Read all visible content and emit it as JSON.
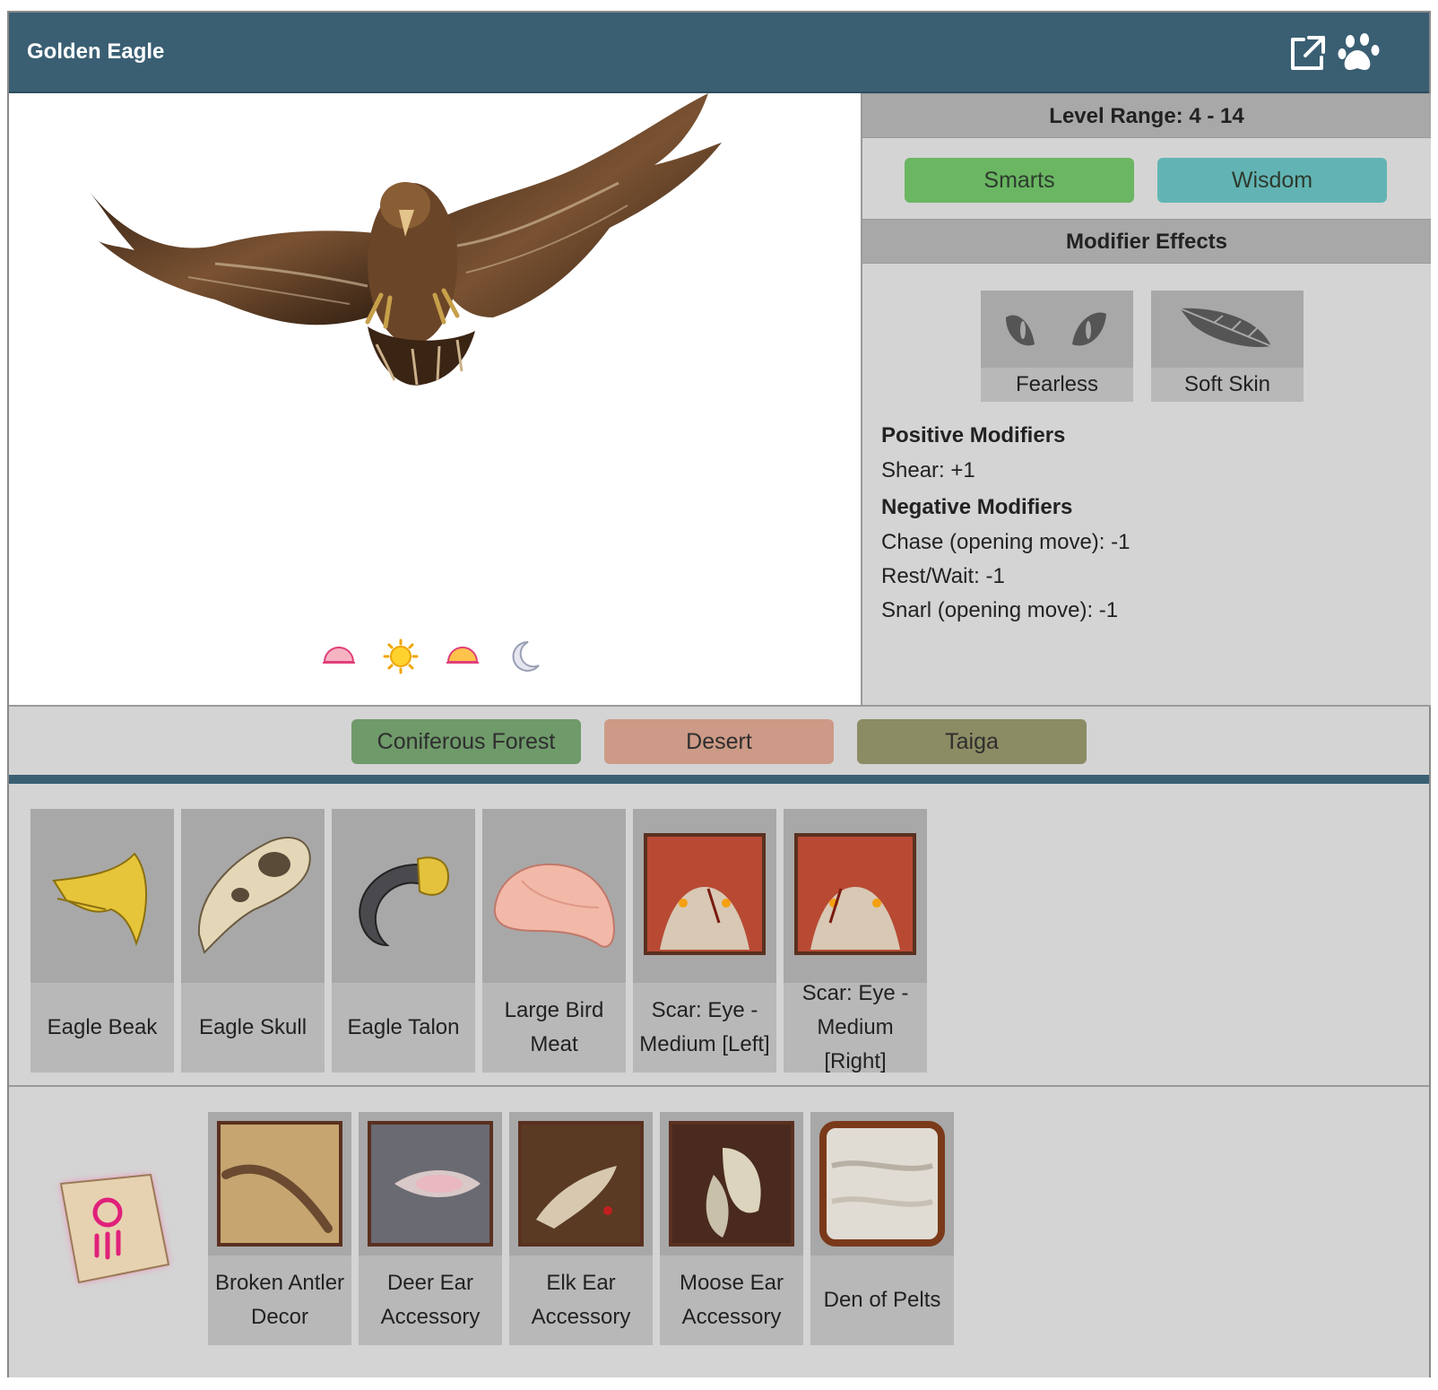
{
  "header": {
    "title": "Golden Eagle",
    "icons": [
      "external-link-icon",
      "paw-icon"
    ]
  },
  "portrait": {
    "time_icons": [
      "dawn-icon",
      "day-sun-icon",
      "dusk-icon",
      "night-moon-icon"
    ]
  },
  "info": {
    "level_range": "Level Range: 4 - 14",
    "stats": [
      {
        "label": "Smarts",
        "color": "#6ab662"
      },
      {
        "label": "Wisdom",
        "color": "#62b4b4"
      }
    ],
    "modifier_effects_title": "Modifier Effects",
    "effects": [
      {
        "label": "Fearless",
        "icon": "eyes-icon"
      },
      {
        "label": "Soft Skin",
        "icon": "feather-icon"
      }
    ],
    "positive_title": "Positive Modifiers",
    "positive": [
      "Shear: +1"
    ],
    "negative_title": "Negative Modifiers",
    "negative": [
      "Chase (opening move): -1",
      "Rest/Wait: -1",
      "Snarl (opening move): -1"
    ]
  },
  "biomes": [
    {
      "label": "Coniferous Forest",
      "color": "#6f9a6a"
    },
    {
      "label": "Desert",
      "color": "#cc9a86"
    },
    {
      "label": "Taiga",
      "color": "#8c8c64"
    }
  ],
  "drops": [
    {
      "label": "Eagle Beak"
    },
    {
      "label": "Eagle Skull"
    },
    {
      "label": "Eagle Talon"
    },
    {
      "label": "Large Bird Meat"
    },
    {
      "label": "Scar: Eye - Medium [Left]"
    },
    {
      "label": "Scar: Eye - Medium [Right]"
    }
  ],
  "rewards": [
    {
      "label": "Broken Antler Decor"
    },
    {
      "label": "Deer Ear Accessory"
    },
    {
      "label": "Elk Ear Accessory"
    },
    {
      "label": "Moose Ear Accessory"
    },
    {
      "label": "Den of Pelts"
    }
  ],
  "colors": {
    "header": "#3a5f73",
    "panel": "#d4d4d4",
    "bar": "#a8a8a8"
  }
}
